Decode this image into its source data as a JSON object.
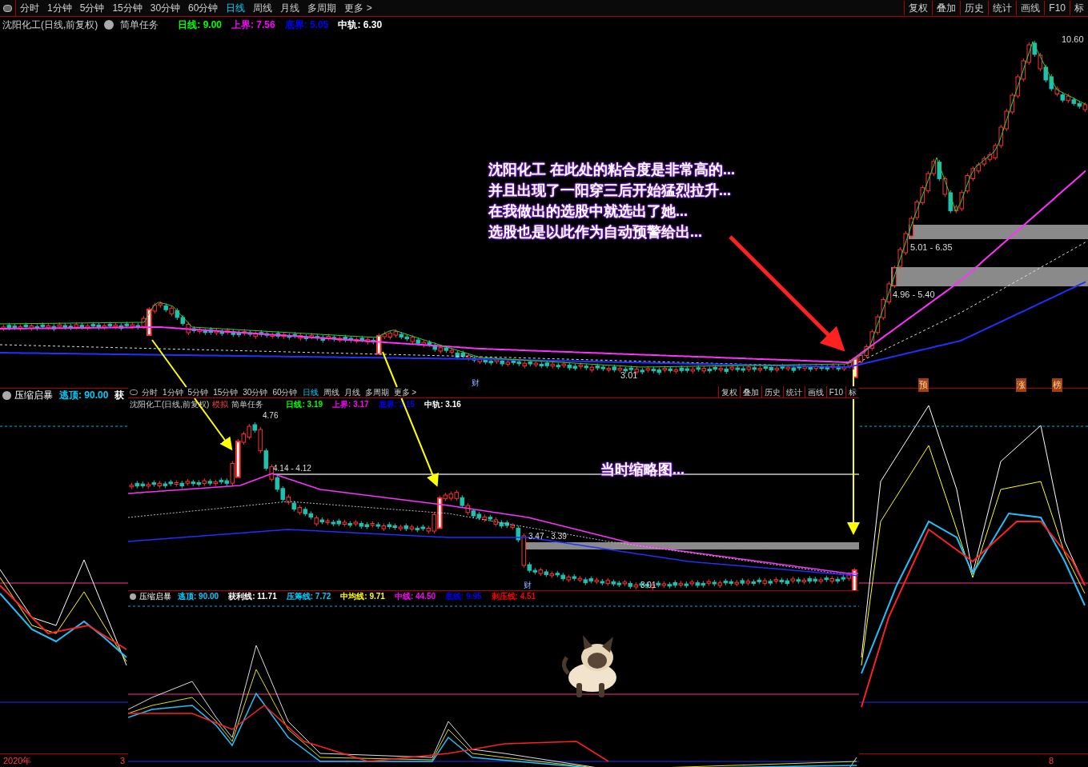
{
  "toolbar": {
    "periods": [
      {
        "label": "分时",
        "selected": false
      },
      {
        "label": "1分钟",
        "selected": false
      },
      {
        "label": "5分钟",
        "selected": false
      },
      {
        "label": "15分钟",
        "selected": false
      },
      {
        "label": "30分钟",
        "selected": false
      },
      {
        "label": "60分钟",
        "selected": false
      },
      {
        "label": "日线",
        "selected": true
      },
      {
        "label": "周线",
        "selected": false
      },
      {
        "label": "月线",
        "selected": false
      },
      {
        "label": "多周期",
        "selected": false
      },
      {
        "label": "更多 >",
        "selected": false
      }
    ],
    "actions": [
      "复权",
      "叠加",
      "历史",
      "统计",
      "画线",
      "F10",
      "标"
    ]
  },
  "stock_header": {
    "title": "沈阳化工(日线,前复权)",
    "task": "简单任务",
    "indicators": [
      {
        "label": "日线: 9.00",
        "color": "#00ff00"
      },
      {
        "label": "上界: 7.56",
        "color": "#ff00ff"
      },
      {
        "label": "底界: 5.05",
        "color": "#0000ff"
      },
      {
        "label": "中轨: 6.30",
        "color": "#ffffff"
      }
    ]
  },
  "main_chart": {
    "high_label": "10.60",
    "low_label": "3.01",
    "zones": [
      "5.01 - 6.35",
      "4.96 - 5.40"
    ],
    "finance_marker": "财",
    "annotation": [
      "沈阳化工 在此处的粘合度是非常高的...",
      "并且出现了一阳穿三后开始猛烈拉升...",
      "在我做出的选股中就选出了她...",
      "选股也是以此作为自动预警给出..."
    ],
    "event_markers": [
      "预",
      "涨",
      "榜"
    ]
  },
  "indicator_panel": {
    "name": "压缩启暴",
    "readings": [
      {
        "label": "逃顶: 90.00",
        "color": "#00ccff"
      },
      {
        "label": "获",
        "color": "#ffffff"
      }
    ]
  },
  "inset": {
    "periods": [
      {
        "label": "分时",
        "selected": false
      },
      {
        "label": "1分钟",
        "selected": false
      },
      {
        "label": "5分钟",
        "selected": false
      },
      {
        "label": "15分钟",
        "selected": false
      },
      {
        "label": "30分钟",
        "selected": false
      },
      {
        "label": "60分钟",
        "selected": false
      },
      {
        "label": "日线",
        "selected": true
      },
      {
        "label": "周线",
        "selected": false
      },
      {
        "label": "月线",
        "selected": false
      },
      {
        "label": "多周期",
        "selected": false
      },
      {
        "label": "更多 >",
        "selected": false
      }
    ],
    "actions": [
      "复权",
      "叠加",
      "历史",
      "统计",
      "画线",
      "F10",
      "标"
    ],
    "title": "沈阳化工(日线,前复权)",
    "badge": "模拟",
    "task": "简单任务",
    "indicators": [
      {
        "label": "日线: 3.19",
        "color": "#00ff00"
      },
      {
        "label": "上界: 3.17",
        "color": "#ff00ff"
      },
      {
        "label": "底界: 3.15",
        "color": "#0000ff"
      },
      {
        "label": "中轨: 3.16",
        "color": "#ffffff"
      }
    ],
    "high_label": "4.76",
    "low_label": "3.01",
    "zones": [
      "4.14 - 4.12",
      "3.47 - 3.39"
    ],
    "finance_marker": "财",
    "caption": "当时缩略图...",
    "indicator_name": "压缩启暴",
    "indicator_readings": [
      {
        "label": "逃顶: 90.00",
        "color": "#00ccff"
      },
      {
        "label": "获利线: 11.71",
        "color": "#ffffff"
      },
      {
        "label": "压筹线: 7.72",
        "color": "#00ccff"
      },
      {
        "label": "中均线: 9.71",
        "color": "#ffff00"
      },
      {
        "label": "中线: 44.50",
        "color": "#ff00ff"
      },
      {
        "label": "底线: 9.95",
        "color": "#0000ff"
      },
      {
        "label": "刺压线: 4.51",
        "color": "#ff0000"
      }
    ]
  },
  "time_axis": [
    "2020年",
    "3",
    "8"
  ]
}
